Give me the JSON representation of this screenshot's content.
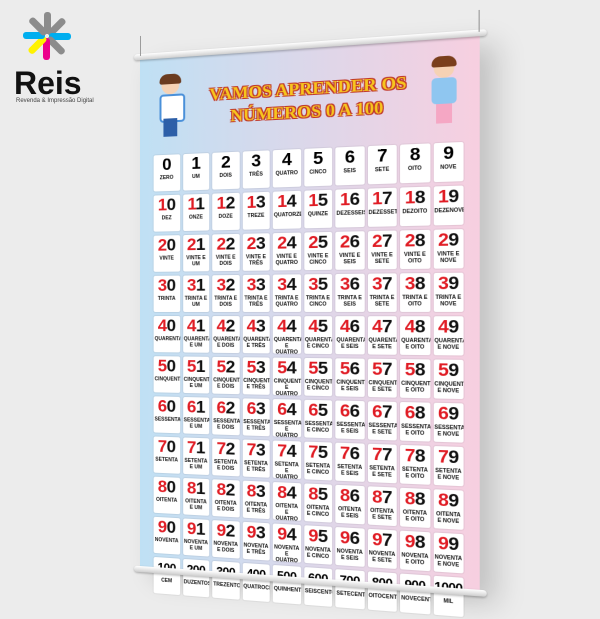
{
  "brand": {
    "name": "Reis",
    "tagline": "Revenda & Impressão Digital",
    "colors": [
      "#8c8c8c",
      "#00aeef",
      "#ec008c",
      "#fff200"
    ]
  },
  "banner": {
    "title_line1": "VAMOS APRENDER OS",
    "title_line2": "NÚMEROS 0 A 100",
    "background_colors": [
      "#bfe0f4",
      "#f7cfe0"
    ],
    "tens_digit_color": "#e01c24",
    "illustrations": [
      "boy",
      "girl"
    ],
    "cells": [
      {
        "number": "0",
        "word": "ZERO"
      },
      {
        "number": "1",
        "word": "UM"
      },
      {
        "number": "2",
        "word": "DOIS"
      },
      {
        "number": "3",
        "word": "TRÊS"
      },
      {
        "number": "4",
        "word": "QUATRO"
      },
      {
        "number": "5",
        "word": "CINCO"
      },
      {
        "number": "6",
        "word": "SEIS"
      },
      {
        "number": "7",
        "word": "SETE"
      },
      {
        "number": "8",
        "word": "OITO"
      },
      {
        "number": "9",
        "word": "NOVE"
      },
      {
        "number": "10",
        "word": "DEZ"
      },
      {
        "number": "11",
        "word": "ONZE"
      },
      {
        "number": "12",
        "word": "DOZE"
      },
      {
        "number": "13",
        "word": "TREZE"
      },
      {
        "number": "14",
        "word": "QUATORZE"
      },
      {
        "number": "15",
        "word": "QUINZE"
      },
      {
        "number": "16",
        "word": "DEZESSEIS"
      },
      {
        "number": "17",
        "word": "DEZESSETE"
      },
      {
        "number": "18",
        "word": "DEZOITO"
      },
      {
        "number": "19",
        "word": "DEZENOVE"
      },
      {
        "number": "20",
        "word": "VINTE"
      },
      {
        "number": "21",
        "word": "VINTE E UM"
      },
      {
        "number": "22",
        "word": "VINTE E DOIS"
      },
      {
        "number": "23",
        "word": "VINTE E TRÊS"
      },
      {
        "number": "24",
        "word": "VINTE E QUATRO"
      },
      {
        "number": "25",
        "word": "VINTE E CINCO"
      },
      {
        "number": "26",
        "word": "VINTE E SEIS"
      },
      {
        "number": "27",
        "word": "VINTE E SETE"
      },
      {
        "number": "28",
        "word": "VINTE E OITO"
      },
      {
        "number": "29",
        "word": "VINTE E NOVE"
      },
      {
        "number": "30",
        "word": "TRINTA"
      },
      {
        "number": "31",
        "word": "TRINTA E UM"
      },
      {
        "number": "32",
        "word": "TRINTA E DOIS"
      },
      {
        "number": "33",
        "word": "TRINTA E TRÊS"
      },
      {
        "number": "34",
        "word": "TRINTA E QUATRO"
      },
      {
        "number": "35",
        "word": "TRINTA E CINCO"
      },
      {
        "number": "36",
        "word": "TRINTA E SEIS"
      },
      {
        "number": "37",
        "word": "TRINTA E SETE"
      },
      {
        "number": "38",
        "word": "TRINTA E OITO"
      },
      {
        "number": "39",
        "word": "TRINTA E NOVE"
      },
      {
        "number": "40",
        "word": "QUARENTA"
      },
      {
        "number": "41",
        "word": "QUARENTA E UM"
      },
      {
        "number": "42",
        "word": "QUARENTA E DOIS"
      },
      {
        "number": "43",
        "word": "QUARENTA E TRÊS"
      },
      {
        "number": "44",
        "word": "QUARENTA E QUATRO"
      },
      {
        "number": "45",
        "word": "QUARENTA E CINCO"
      },
      {
        "number": "46",
        "word": "QUARENTA E SEIS"
      },
      {
        "number": "47",
        "word": "QUARENTA E SETE"
      },
      {
        "number": "48",
        "word": "QUARENTA E OITO"
      },
      {
        "number": "49",
        "word": "QUARENTA E NOVE"
      },
      {
        "number": "50",
        "word": "CINQUENTA"
      },
      {
        "number": "51",
        "word": "CINQUENTA E UM"
      },
      {
        "number": "52",
        "word": "CINQUENTA E DOIS"
      },
      {
        "number": "53",
        "word": "CINQUENTA E TRÊS"
      },
      {
        "number": "54",
        "word": "CINQUENTA E QUATRO"
      },
      {
        "number": "55",
        "word": "CINQUENTA E CINCO"
      },
      {
        "number": "56",
        "word": "CINQUENTA E SEIS"
      },
      {
        "number": "57",
        "word": "CINQUENTA E SETE"
      },
      {
        "number": "58",
        "word": "CINQUENTA E OITO"
      },
      {
        "number": "59",
        "word": "CINQUENTA E NOVE"
      },
      {
        "number": "60",
        "word": "SESSENTA"
      },
      {
        "number": "61",
        "word": "SESSENTA E UM"
      },
      {
        "number": "62",
        "word": "SESSENTA E DOIS"
      },
      {
        "number": "63",
        "word": "SESSENTA E TRÊS"
      },
      {
        "number": "64",
        "word": "SESSENTA E QUATRO"
      },
      {
        "number": "65",
        "word": "SESSENTA E CINCO"
      },
      {
        "number": "66",
        "word": "SESSENTA E SEIS"
      },
      {
        "number": "67",
        "word": "SESSENTA E SETE"
      },
      {
        "number": "68",
        "word": "SESSENTA E OITO"
      },
      {
        "number": "69",
        "word": "SESSENTA E NOVE"
      },
      {
        "number": "70",
        "word": "SETENTA"
      },
      {
        "number": "71",
        "word": "SETENTA E UM"
      },
      {
        "number": "72",
        "word": "SETENTA E DOIS"
      },
      {
        "number": "73",
        "word": "SETENTA E TRÊS"
      },
      {
        "number": "74",
        "word": "SETENTA E QUATRO"
      },
      {
        "number": "75",
        "word": "SETENTA E CINCO"
      },
      {
        "number": "76",
        "word": "SETENTA E SEIS"
      },
      {
        "number": "77",
        "word": "SETENTA E SETE"
      },
      {
        "number": "78",
        "word": "SETENTA E OITO"
      },
      {
        "number": "79",
        "word": "SETENTA E NOVE"
      },
      {
        "number": "80",
        "word": "OITENTA"
      },
      {
        "number": "81",
        "word": "OITENTA E UM"
      },
      {
        "number": "82",
        "word": "OITENTA E DOIS"
      },
      {
        "number": "83",
        "word": "OITENTA E TRÊS"
      },
      {
        "number": "84",
        "word": "OITENTA E QUATRO"
      },
      {
        "number": "85",
        "word": "OITENTA E CINCO"
      },
      {
        "number": "86",
        "word": "OITENTA E SEIS"
      },
      {
        "number": "87",
        "word": "OITENTA E SETE"
      },
      {
        "number": "88",
        "word": "OITENTA E OITO"
      },
      {
        "number": "89",
        "word": "OITENTA E NOVE"
      },
      {
        "number": "90",
        "word": "NOVENTA"
      },
      {
        "number": "91",
        "word": "NOVENTA E UM"
      },
      {
        "number": "92",
        "word": "NOVENTA E DOIS"
      },
      {
        "number": "93",
        "word": "NOVENTA E TRÊS"
      },
      {
        "number": "94",
        "word": "NOVENTA E QUATRO"
      },
      {
        "number": "95",
        "word": "NOVENTA E CINCO"
      },
      {
        "number": "96",
        "word": "NOVENTA E SEIS"
      },
      {
        "number": "97",
        "word": "NOVENTA E SETE"
      },
      {
        "number": "98",
        "word": "NOVENTA E OITO"
      },
      {
        "number": "99",
        "word": "NOVENTA E NOVE"
      },
      {
        "number": "100",
        "word": "CEM"
      },
      {
        "number": "200",
        "word": "DUZENTOS"
      },
      {
        "number": "300",
        "word": "TREZENTOS"
      },
      {
        "number": "400",
        "word": "QUATROCENTOS"
      },
      {
        "number": "500",
        "word": "QUINHENTOS"
      },
      {
        "number": "600",
        "word": "SEISCENTOS"
      },
      {
        "number": "700",
        "word": "SETECENTOS"
      },
      {
        "number": "800",
        "word": "OITOCENTOS"
      },
      {
        "number": "900",
        "word": "NOVECENTOS"
      },
      {
        "number": "1000",
        "word": "MIL"
      }
    ]
  }
}
